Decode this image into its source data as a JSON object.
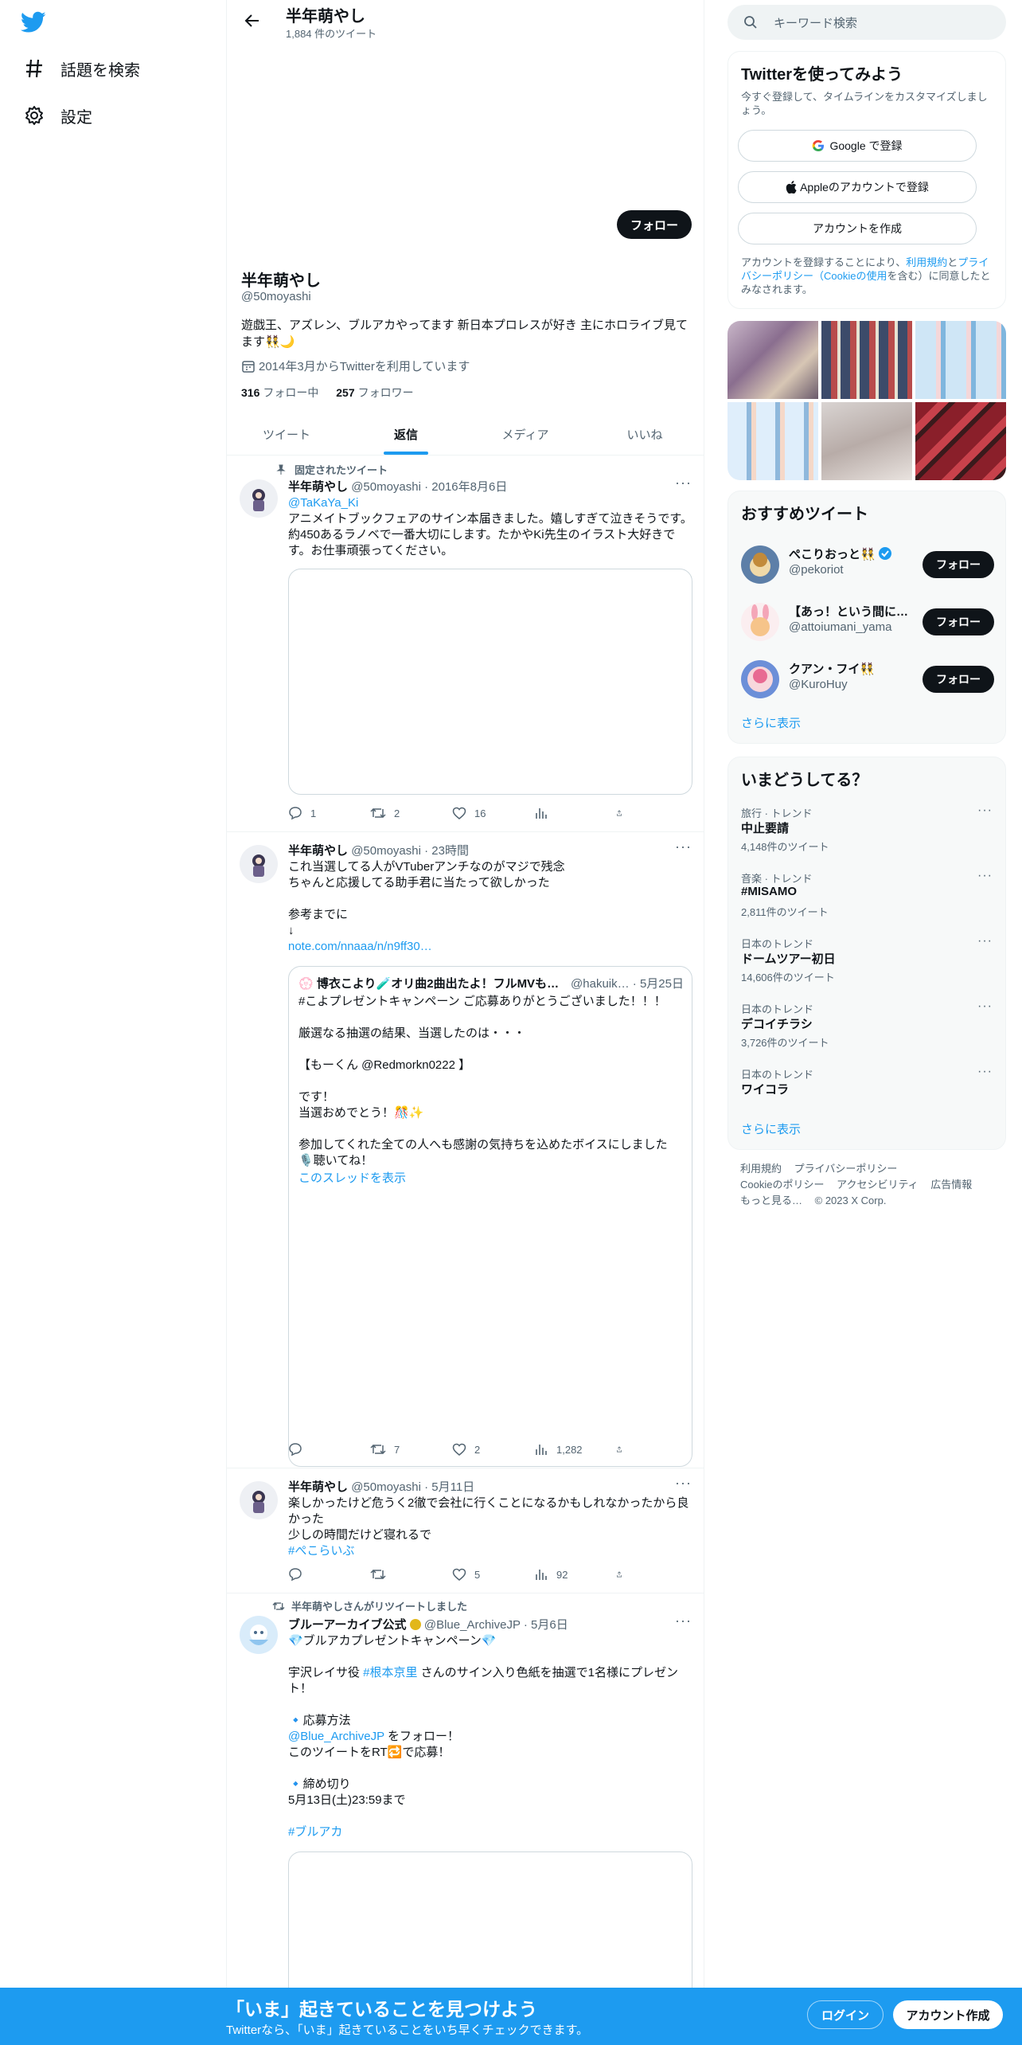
{
  "nav": {
    "explore_label": "話題を検索",
    "settings_label": "設定"
  },
  "profile": {
    "header_name": "半年萌やし",
    "tweet_count": "1,884 件のツイート",
    "follow_label": "フォロー",
    "name": "半年萌やし",
    "handle": "@50moyashi",
    "bio": "遊戯王、アズレン、ブルアカやってます 新日本プロレスが好き 主にホロライブ見てます👯🌙",
    "joined": "2014年3月からTwitterを利用しています",
    "following_count": "316",
    "following_label": "フォロー中",
    "followers_count": "257",
    "followers_label": "フォロワー"
  },
  "tabs": [
    "ツイート",
    "返信",
    "メディア",
    "いいね"
  ],
  "tweets": [
    {
      "pinned_label": "固定されたツイート",
      "name": "半年萌やし",
      "handle_time": "@50moyashi · 2016年8月6日",
      "reply_to": "@TaKaYa_Ki",
      "text": "アニメイトブックフェアのサイン本届きました。嬉しすぎて泣きそうです。約450あるラノベで一番大切にします。たかやKi先生のイラスト大好きです。お仕事頑張ってください。",
      "replies": "1",
      "retweets": "2",
      "likes": "16",
      "views": "",
      "more": "···"
    },
    {
      "name": "半年萌やし",
      "handle_time": "@50moyashi · 23時間",
      "text": "これ当選してる人がVTuberアンチなのがマジで残念\nちゃんと応援してる助手君に当たって欲しかった\n\n参考までに\n↓",
      "link": "note.com/nnaaa/n/n9ff30…",
      "quote": {
        "name": "💮 博衣こより🧪オリ曲2曲出たよ！フルMVも…",
        "handle_time": "@hakuik… · 5月25日",
        "text": "#こよプレゼントキャンペーン ご応募ありがとうございました！！！\n\n厳選なる抽選の結果、当選したのは・・・\n\n【もーくん @Redmorkn0222 】\n\nです！\n当選おめでとう！🎊✨\n\n参加してくれた全ての人へも感謝の気持ちを込めたボイスにしました\n🎙️聴いてね！",
        "show_thread": "このスレッドを表示"
      },
      "replies": "",
      "retweets": "7",
      "likes": "2",
      "views": "1,282",
      "more": "···"
    },
    {
      "name": "半年萌やし",
      "handle_time": "@50moyashi · 5月11日",
      "text": "楽しかったけど危うく2徹で会社に行くことになるかもしれなかったから良かった\n少しの時間だけど寝れるで",
      "hashtag": "#ぺこらいぶ",
      "replies": "",
      "retweets": "",
      "likes": "5",
      "views": "92",
      "more": "···"
    },
    {
      "retweeted_label": "半年萌やしさんがリツイートしました",
      "name": "ブルーアーカイブ公式",
      "handle_time": "@Blue_ArchiveJP · 5月6日",
      "line1": "💎ブルアカプレゼントキャンペーン💎",
      "line2_pre": "宇沢レイサ役 ",
      "line2_tag": "#根本京里",
      "line2_post": " さんのサイン入り色紙を抽選で1名様にプレゼント！",
      "howto_label": "🔹応募方法",
      "howto_link": "@Blue_ArchiveJP",
      "howto_text1": " をフォロー！",
      "howto_text2": "このツイートをRT🔁で応募！",
      "deadline_label": "🔹締め切り",
      "deadline_text": "5月13日(土)23:59まで",
      "hashtag": "#ブルアカ",
      "more": "···"
    }
  ],
  "search": {
    "placeholder": "キーワード検索"
  },
  "signup": {
    "title": "Twitterを使ってみよう",
    "subtitle": "今すぐ登録して、タイムラインをカスタマイズしましょう。",
    "google": "Google で登録",
    "apple": "Appleのアカウントで登録",
    "create": "アカウントを作成",
    "terms_pre": "アカウントを登録することにより、",
    "terms_link1": "利用規約",
    "terms_mid1": "と",
    "terms_link2": "プライバシーポリシー（Cookieの使用",
    "terms_post": "を含む）に同意したとみなされます。"
  },
  "recommend": {
    "title": "おすすめツイート",
    "users": [
      {
        "name": "ぺこりおっと👯",
        "handle": "@pekoriot",
        "verified": true,
        "follow": "フォロー"
      },
      {
        "name": "【あっ！という間に…",
        "handle": "@attoiumani_yama",
        "verified": false,
        "follow": "フォロー"
      },
      {
        "name": "クアン・フイ👯",
        "handle": "@KuroHuy",
        "verified": false,
        "follow": "フォロー"
      }
    ],
    "show_more": "さらに表示"
  },
  "trends": {
    "title": "いまどうしてる？",
    "items": [
      {
        "meta": "旅行 · トレンド",
        "name": "中止要請",
        "count": "4,148件のツイート"
      },
      {
        "meta": "音楽 · トレンド",
        "name": "#MISAMO",
        "count": "2,811件のツイート"
      },
      {
        "meta": "日本のトレンド",
        "name": "ドームツアー初日",
        "count": "14,606件のツイート"
      },
      {
        "meta": "日本のトレンド",
        "name": "デコイチラシ",
        "count": "3,726件のツイート"
      },
      {
        "meta": "日本のトレンド",
        "name": "ワイコラ",
        "count": ""
      }
    ],
    "show_more": "さらに表示"
  },
  "footer": {
    "terms": "利用規約",
    "privacy": "プライバシーポリシー",
    "cookie": "Cookieのポリシー",
    "accessibility": "アクセシビリティ",
    "ads": "広告情報",
    "more": "もっと見る…",
    "copyright": "© 2023 X Corp."
  },
  "bottombar": {
    "title": "「いま」起きていることを見つけよう",
    "subtitle": "Twitterなら、「いま」起きていることをいち早くチェックできます。",
    "login": "ログイン",
    "signup": "アカウント作成"
  },
  "colors": {
    "accent": "#1d9bf0",
    "text": "#0f1419",
    "muted": "#536471"
  }
}
